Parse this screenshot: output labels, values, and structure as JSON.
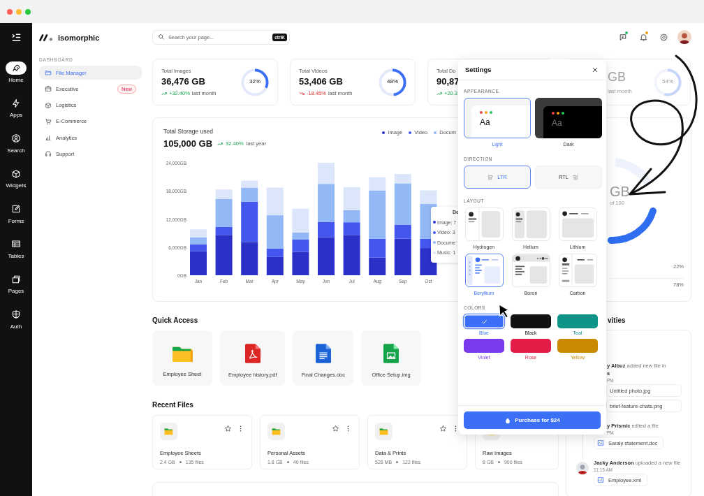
{
  "rail": [
    {
      "label": "Home",
      "selected": true
    },
    {
      "label": "Apps",
      "selected": false
    },
    {
      "label": "Search",
      "selected": false
    },
    {
      "label": "Widgets",
      "selected": false
    },
    {
      "label": "Forms",
      "selected": false
    },
    {
      "label": "Tables",
      "selected": false
    },
    {
      "label": "Pages",
      "selected": false
    },
    {
      "label": "Auth",
      "selected": false
    }
  ],
  "brand": "isomorphic",
  "sidebar": {
    "section": "DASHBOARD",
    "items": [
      {
        "label": "File Manager",
        "selected": true
      },
      {
        "label": "Executive",
        "selected": false,
        "badge": "New"
      },
      {
        "label": "Logistics",
        "selected": false
      },
      {
        "label": "E-Commerce",
        "selected": false
      },
      {
        "label": "Analytics",
        "selected": false
      },
      {
        "label": "Support",
        "selected": false
      }
    ]
  },
  "search": {
    "placeholder": "Search your page...",
    "shortcut": "ctrlK"
  },
  "header_icons": [
    {
      "kind": "chat",
      "color": "#22c55e"
    },
    {
      "kind": "bell",
      "color": "#f59e0b"
    },
    {
      "kind": "settings"
    }
  ],
  "stats": [
    {
      "title": "Total Images",
      "value": "36,476 GB",
      "change": "+32.40%",
      "rising": true,
      "note": "last month",
      "percent": "32%",
      "level": 0.32,
      "faded": false
    },
    {
      "title": "Total Videos",
      "value": "53,406 GB",
      "change": "-18.45%",
      "rising": false,
      "note": "last month",
      "percent": "48%",
      "level": 0.48,
      "faded": false
    },
    {
      "title": "Total Do",
      "value": "90,87",
      "change": "+20.3",
      "rising": true,
      "faded": false
    },
    {
      "value": "GB",
      "note": "last month",
      "percent": "54%",
      "level": 0.54,
      "faded": true
    }
  ],
  "storage_chart": {
    "title": "Total Storage used",
    "total": "105,000 GB",
    "change": "32.40%",
    "rising": true,
    "note": "last year",
    "chart_data": {
      "type": "bar",
      "stacked": true,
      "categories": [
        "Jan",
        "Feb",
        "Mar",
        "Apr",
        "May",
        "Jun",
        "Jul",
        "Aug",
        "Sep",
        "Oct"
      ],
      "ylim": [
        0,
        24000
      ],
      "yticks": [
        {
          "value": 0,
          "label": "0GB"
        },
        {
          "value": 6000,
          "label": "6,000GB"
        },
        {
          "value": 12000,
          "label": "12,000GB"
        },
        {
          "value": 18000,
          "label": "18,000GB"
        },
        {
          "value": 24000,
          "label": "24,000GB"
        }
      ],
      "series": [
        {
          "name": "Image",
          "color": "#2b30c9",
          "values": [
            5100,
            8600,
            7100,
            3900,
            5000,
            8100,
            8600,
            3800,
            7800,
            5800
          ]
        },
        {
          "name": "Video",
          "color": "#4356ee",
          "values": [
            1500,
            1700,
            8600,
            1800,
            2600,
            3300,
            2700,
            4000,
            3000,
            2000
          ]
        },
        {
          "name": "Docum",
          "color": "#93b8f6",
          "values": [
            1500,
            6000,
            3000,
            7100,
            1500,
            8100,
            2600,
            10300,
            8800,
            7400
          ]
        },
        {
          "color": "#dbe6fb",
          "values": [
            1700,
            2000,
            1500,
            5900,
            5100,
            4500,
            4900,
            2800,
            2000,
            2900
          ]
        }
      ]
    },
    "tooltip": {
      "title": "De",
      "rows": [
        {
          "label": "Image: 7",
          "color": "#2b30c9"
        },
        {
          "label": "Video: 3",
          "color": "#4356ee"
        },
        {
          "label": "Docume",
          "color": "#93b8f6"
        },
        {
          "label": "Music: 1",
          "color": "#dbe6fb"
        }
      ]
    }
  },
  "storage_card": {
    "value": "GB",
    "caption": "of 100",
    "shares": [
      "22%",
      "78%"
    ],
    "faded": true
  },
  "quick_access": {
    "title": "Quick Access",
    "items": [
      {
        "name": "Employee Sheet",
        "kind": "folder"
      },
      {
        "name": "Employee history.pdf",
        "kind": "pdf"
      },
      {
        "name": "Final Changes.doc",
        "kind": "doc"
      },
      {
        "name": "Office Setup.img",
        "kind": "image"
      }
    ]
  },
  "recent_files": {
    "title": "Recent Files",
    "items": [
      {
        "name": "Employee Sheets",
        "size": "2.4 GB",
        "count": "135 files"
      },
      {
        "name": "Personal Assets",
        "size": "1.8 GB",
        "count": "40 files"
      },
      {
        "name": "Data & Prints",
        "size": "528 MB",
        "count": "122 files"
      },
      {
        "name": "Raw Images",
        "size": "8 GB",
        "count": "900 files"
      }
    ]
  },
  "activities": {
    "title": "vities",
    "items": [
      {
        "text": "**y Albuz** added new file in",
        "line2": "s",
        "time": "PM",
        "avatar": false,
        "files": [
          {
            "name": "Untitled photo.jpg",
            "icon": false
          },
          {
            "name": "brief-feature-chats.png",
            "icon": false
          }
        ]
      },
      {
        "text": "**y Prismic** edited a file",
        "time": "PM",
        "avatar": false,
        "files": [
          {
            "name": "Saraly statement.doc",
            "icon": true
          }
        ]
      },
      {
        "text": "**Jacky Anderson** uploaded a new file",
        "time": "11:15 AM",
        "avatar": true,
        "files": [
          {
            "name": "Employee.xml",
            "icon": true
          }
        ]
      }
    ]
  },
  "settings": {
    "title": "Settings",
    "appearance": {
      "heading": "APPEARANCE",
      "options": [
        {
          "label": "Light",
          "kind": "light",
          "preview": "Aa",
          "selected": true
        },
        {
          "label": "Dark",
          "kind": "dark",
          "preview": "Aa",
          "selected": false
        }
      ]
    },
    "direction": {
      "heading": "DIRECTION",
      "options": [
        {
          "label": "LTR",
          "kind": "ltr",
          "selected": true
        },
        {
          "label": "RTL",
          "kind": "rtl",
          "selected": false
        }
      ]
    },
    "layout": {
      "heading": "LAYOUT",
      "options": [
        {
          "label": "Hydrogen",
          "selected": false
        },
        {
          "label": "Helium",
          "selected": false
        },
        {
          "label": "Lithium",
          "selected": false
        },
        {
          "label": "Beryllium",
          "selected": true
        },
        {
          "label": "Boron",
          "selected": false
        },
        {
          "label": "Carbon",
          "selected": false
        }
      ]
    },
    "colors": {
      "heading": "COLORS",
      "options": [
        {
          "label": "Blue",
          "color": "#3b6ff5",
          "selected": true
        },
        {
          "label": "Black",
          "color": "#111111",
          "selected": false
        },
        {
          "label": "Teal",
          "color": "#0f9488",
          "selected": false
        },
        {
          "label": "Violet",
          "color": "#7c3aed",
          "selected": false
        },
        {
          "label": "Rose",
          "color": "#e11d48",
          "selected": false
        },
        {
          "label": "Yellow",
          "color": "#ca8a04",
          "selected": false
        }
      ]
    },
    "purchase": "Purchase for $24"
  }
}
